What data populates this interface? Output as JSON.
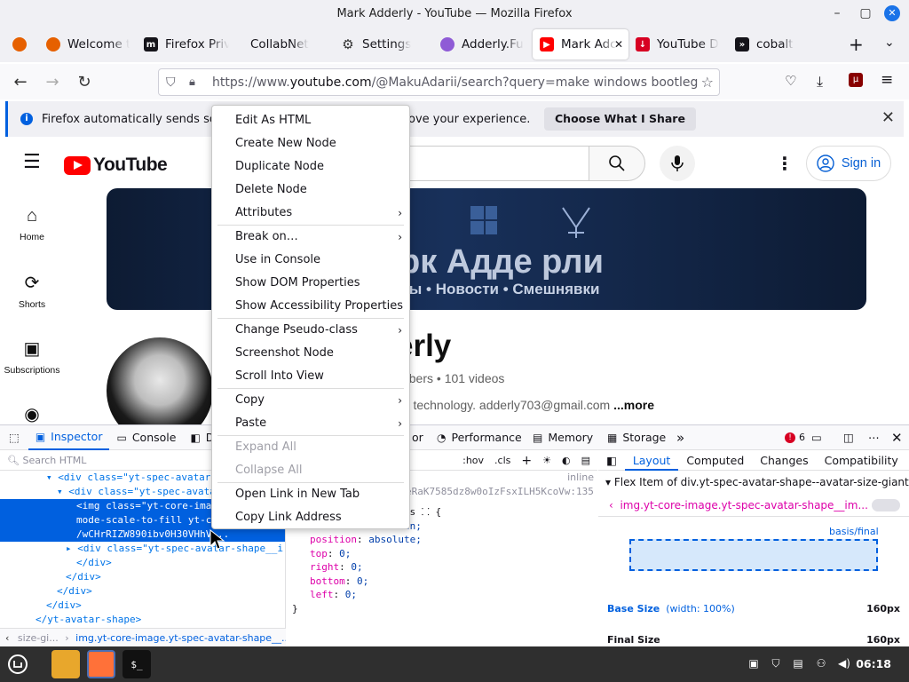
{
  "window": {
    "title": "Mark Adderly - YouTube — Mozilla Firefox"
  },
  "tabs": [
    {
      "label": "",
      "color": "#e66000"
    },
    {
      "label": "Welcome t",
      "color": "#e66000"
    },
    {
      "label": "Firefox Priv",
      "color": "#15141a"
    },
    {
      "label": "CollabNet",
      "color": ""
    },
    {
      "label": "Settings",
      "color": ""
    },
    {
      "label": "Adderly.Fu",
      "color": "#8f5bd6"
    },
    {
      "label": "Mark Adc",
      "color": "#ff0000",
      "active": true
    },
    {
      "label": "YouTube D",
      "color": "#d70022"
    },
    {
      "label": "cobalt",
      "color": "#15141a"
    }
  ],
  "urlbar": {
    "prefix": "https://www.",
    "domain": "youtube.com",
    "path": "/@MakuAdarii/search?query=make windows bootleg"
  },
  "notification": {
    "text": "Firefox automatically sends som",
    "text_tail": "ove your experience.",
    "button": "Choose What I Share"
  },
  "youtube": {
    "logo": "YouTube",
    "sign_in": "Sign in",
    "sidebar": [
      {
        "label": "Home",
        "icon": "home-icon"
      },
      {
        "label": "Shorts",
        "icon": "shorts-icon"
      },
      {
        "label": "Subscriptions",
        "icon": "subscriptions-icon"
      },
      {
        "label": "",
        "icon": "you-icon"
      }
    ],
    "banner_title": "рк Адде рли",
    "banner_sub": "лы • Новости • Смешнявки",
    "channel_name": "erly",
    "channel_meta": "cribers • 101 videos",
    "channel_desc": "nd technology. adderly703@gmail.com",
    "more": "...more"
  },
  "devtools": {
    "tabs": [
      "Inspector",
      "Console",
      "D",
      "or",
      "Performance",
      "Memory",
      "Storage"
    ],
    "error_count": "6",
    "search_placeholder": "Search HTML",
    "markup": [
      {
        "indent": 52,
        "text": "▾ <div class=\"yt-spec-avatar"
      },
      {
        "indent": 64,
        "text": "▾ <div class=\"yt-spec-avata"
      },
      {
        "indent": 86,
        "text": "<img class=\"yt-core-imag",
        "sel": true
      },
      {
        "indent": 86,
        "text": "mode-scale-to-fill yt-c",
        "sel": true
      },
      {
        "indent": 86,
        "text": "/wCHrRIZW890ibv0H30VHhV...",
        "sel": true
      },
      {
        "indent": 74,
        "text": "▸ <div class=\"yt-spec-avatar-shape__i"
      },
      {
        "indent": 86,
        "text": "</div>"
      },
      {
        "indent": 74,
        "text": "</div>"
      },
      {
        "indent": 64,
        "text": "</div>"
      },
      {
        "indent": 52,
        "text": "</div>"
      },
      {
        "indent": 40,
        "text": "</yt-avatar-shape>"
      }
    ],
    "breadcrumb": [
      "size-gi...",
      "img.yt-core-image.yt-spec-avatar-shape__..."
    ],
    "rules_toolbar": [
      ":hov",
      ".cls",
      "+"
    ],
    "rules_inline": "inline",
    "rules_hash": "eRaK7585dz8w0oIzFsxILH5KcoVw:135",
    "rules_selector": "shape__image-overlays ⸬ {",
    "rules": [
      {
        "p": "overflow",
        "v": "▸ hidden;"
      },
      {
        "p": "position",
        "v": "absolute;"
      },
      {
        "p": "top",
        "v": "0;"
      },
      {
        "p": "right",
        "v": "0;"
      },
      {
        "p": "bottom",
        "v": "0;"
      },
      {
        "p": "left",
        "v": "0;"
      }
    ],
    "rules_close": "}",
    "layout_tabs": [
      "Layout",
      "Computed",
      "Changes",
      "Compatibility"
    ],
    "flex_item": "Flex Item of div.yt-spec-avatar-shape--avatar-size-giant",
    "flex_selector": "img.yt-core-image.yt-spec-avatar-shape__im...",
    "basis_label": "basis/final",
    "base_size_label": "Base Size",
    "base_size_note": "(width: 100%)",
    "base_size_value": "160px",
    "final_size_label": "Final Size",
    "final_size_value": "160px"
  },
  "context_menu": [
    {
      "label": "Edit As HTML"
    },
    {
      "label": "Create New Node"
    },
    {
      "label": "Duplicate Node"
    },
    {
      "label": "Delete Node"
    },
    {
      "label": "Attributes",
      "sub": true
    },
    {
      "sep": true
    },
    {
      "label": "Break on…",
      "sub": true
    },
    {
      "label": "Use in Console"
    },
    {
      "label": "Show DOM Properties"
    },
    {
      "label": "Show Accessibility Properties"
    },
    {
      "sep": true
    },
    {
      "label": "Change Pseudo-class",
      "sub": true
    },
    {
      "label": "Screenshot Node"
    },
    {
      "label": "Scroll Into View"
    },
    {
      "sep": true
    },
    {
      "label": "Copy",
      "sub": true
    },
    {
      "label": "Paste",
      "sub": true
    },
    {
      "sep": true
    },
    {
      "label": "Expand All",
      "disabled": true
    },
    {
      "label": "Collapse All",
      "disabled": true
    },
    {
      "sep": true
    },
    {
      "label": "Open Link in New Tab"
    },
    {
      "label": "Copy Link Address"
    }
  ],
  "taskbar": {
    "clock": "06:18"
  }
}
